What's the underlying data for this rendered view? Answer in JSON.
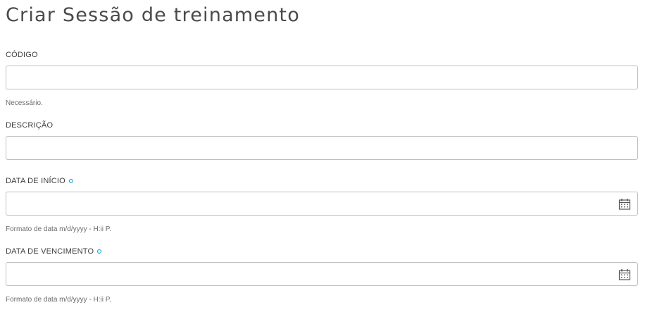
{
  "page": {
    "title": "Criar Sessão de treinamento"
  },
  "form": {
    "code": {
      "label": "CÓDIGO",
      "value": "",
      "placeholder": "",
      "hint": "Necessário."
    },
    "description": {
      "label": "DESCRIÇÃO",
      "value": "",
      "placeholder": ""
    },
    "start_date": {
      "label": "DATA DE INÍCIO",
      "value": "",
      "placeholder": "",
      "hint": "Formato de data m/d/yyyy - H:ii P.",
      "icon": "calendar-icon"
    },
    "due_date": {
      "label": "DATA DE VENCIMENTO",
      "value": "",
      "placeholder": "",
      "hint": "Formato de data m/d/yyyy - H:ii P.",
      "icon": "calendar-icon"
    }
  },
  "colors": {
    "required_indicator": "#0696d7",
    "field_border": "#bfbfbf",
    "title_text": "#4a4a4a"
  }
}
